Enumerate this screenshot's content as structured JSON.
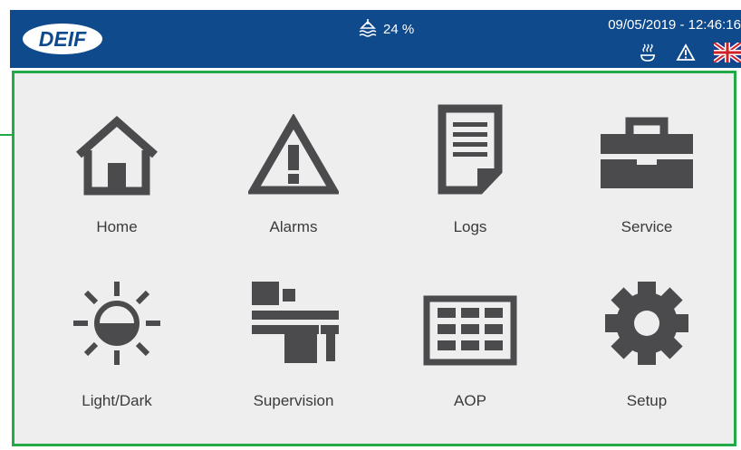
{
  "header": {
    "logo_text": "DEIF",
    "fuel_value": "24 %",
    "datetime": "09/05/2019 - 12:46:16"
  },
  "colors": {
    "header_bg": "#0f4a8c",
    "frame_border": "#22a948",
    "icon": "#4b4b4d",
    "panel_bg": "#eeeeee"
  },
  "icons": {
    "fuel": "fuel-level-icon",
    "heater": "heater-icon",
    "warning": "warning-triangle-icon",
    "language": "uk-flag-icon"
  },
  "menu": {
    "items": [
      {
        "label": "Home",
        "icon": "home-icon"
      },
      {
        "label": "Alarms",
        "icon": "alarm-triangle-icon"
      },
      {
        "label": "Logs",
        "icon": "document-icon"
      },
      {
        "label": "Service",
        "icon": "toolbox-icon"
      },
      {
        "label": "Light/Dark",
        "icon": "brightness-icon"
      },
      {
        "label": "Supervision",
        "icon": "network-icon"
      },
      {
        "label": "AOP",
        "icon": "keypad-grid-icon"
      },
      {
        "label": "Setup",
        "icon": "gear-icon"
      }
    ]
  }
}
